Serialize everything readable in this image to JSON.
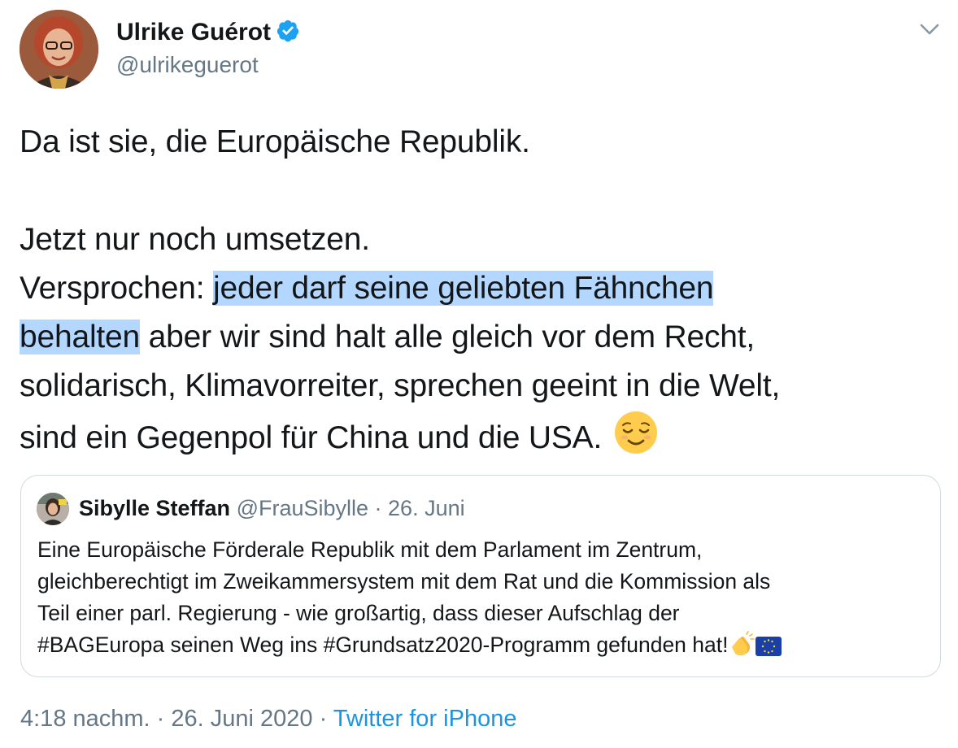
{
  "author": {
    "name": "Ulrike Guérot",
    "handle": "@ulrikeguerot",
    "verified": true
  },
  "tweet": {
    "line1": "Da ist sie, die Europäische Republik.",
    "line2": "Jetzt nur noch umsetzen.",
    "line3_prefix": "Versprochen: ",
    "highlight_part1": "jeder darf seine geliebten Fähnchen ",
    "highlight_part2": "behalten",
    "line4_rest": " aber wir sind halt alle gleich vor dem Recht,",
    "line5": "solidarisch, Klimavorreiter, sprechen geeint in die Welt,",
    "line6": "sind ein Gegenpol für China und die USA. ",
    "emoji": "relieved-face-emoji"
  },
  "quote": {
    "name": "Sibylle Steffan",
    "handle": "@FrauSibylle",
    "separator": " · ",
    "date": "26. Juni",
    "lines": [
      "Eine Europäische Förderale Republik mit dem Parlament im Zentrum,",
      "gleichberechtigt im Zweikammersystem mit dem Rat und die Kommission als",
      "Teil einer parl. Regierung - wie großartig, dass dieser Aufschlag der",
      "#BAGEuropa seinen Weg ins #Grundsatz2020-Programm gefunden hat!"
    ],
    "emojis": [
      "clapping-hands-emoji",
      "eu-flag-emoji"
    ]
  },
  "meta": {
    "time": "4:18 nachm.",
    "separator": " · ",
    "date": "26. Juni 2020",
    "source": "Twitter for iPhone"
  },
  "colors": {
    "highlight": "#b3d7ff",
    "verified": "#1da1f2",
    "link": "#1b95e0",
    "muted": "#657786"
  }
}
